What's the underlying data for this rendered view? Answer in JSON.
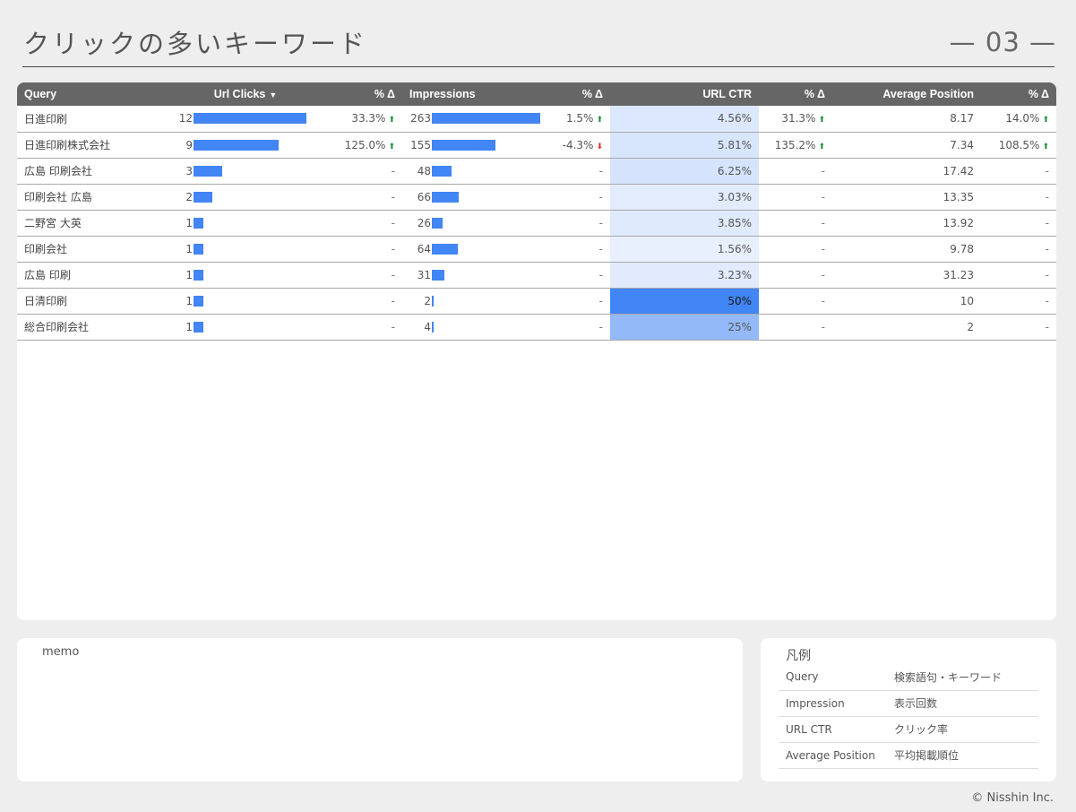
{
  "page": {
    "title": "クリックの多いキーワード",
    "number": "— 03 —",
    "copyright": "© Nisshin Inc."
  },
  "table": {
    "headers": {
      "query": "Query",
      "clicks": "Url Clicks",
      "clicks_delta": "% Δ",
      "impressions": "Impressions",
      "impressions_delta": "% Δ",
      "ctr": "URL CTR",
      "ctr_delta": "% Δ",
      "position": "Average Position",
      "position_delta": "% Δ"
    },
    "sort_caret": "▼",
    "rows": [
      {
        "query": "日進印刷",
        "clicks": "12",
        "clicks_value": 12,
        "clicks_delta": "33.3%",
        "clicks_dir": "up",
        "impressions": "263",
        "impressions_value": 263,
        "impressions_delta": "1.5%",
        "impressions_dir": "up",
        "ctr": "4.56%",
        "ctr_value": 4.56,
        "ctr_delta": "31.3%",
        "ctr_dir": "up",
        "position": "8.17",
        "position_delta": "14.0%",
        "position_dir": "up"
      },
      {
        "query": "日進印刷株式会社",
        "clicks": "9",
        "clicks_value": 9,
        "clicks_delta": "125.0%",
        "clicks_dir": "up",
        "impressions": "155",
        "impressions_value": 155,
        "impressions_delta": "-4.3%",
        "impressions_dir": "down",
        "ctr": "5.81%",
        "ctr_value": 5.81,
        "ctr_delta": "135.2%",
        "ctr_dir": "up",
        "position": "7.34",
        "position_delta": "108.5%",
        "position_dir": "up"
      },
      {
        "query": "広島 印刷会社",
        "clicks": "3",
        "clicks_value": 3,
        "clicks_delta": "-",
        "clicks_dir": "",
        "impressions": "48",
        "impressions_value": 48,
        "impressions_delta": "-",
        "impressions_dir": "",
        "ctr": "6.25%",
        "ctr_value": 6.25,
        "ctr_delta": "-",
        "ctr_dir": "",
        "position": "17.42",
        "position_delta": "-",
        "position_dir": ""
      },
      {
        "query": "印刷会社 広島",
        "clicks": "2",
        "clicks_value": 2,
        "clicks_delta": "-",
        "clicks_dir": "",
        "impressions": "66",
        "impressions_value": 66,
        "impressions_delta": "-",
        "impressions_dir": "",
        "ctr": "3.03%",
        "ctr_value": 3.03,
        "ctr_delta": "-",
        "ctr_dir": "",
        "position": "13.35",
        "position_delta": "-",
        "position_dir": ""
      },
      {
        "query": "二野宮 大英",
        "clicks": "1",
        "clicks_value": 1,
        "clicks_delta": "-",
        "clicks_dir": "",
        "impressions": "26",
        "impressions_value": 26,
        "impressions_delta": "-",
        "impressions_dir": "",
        "ctr": "3.85%",
        "ctr_value": 3.85,
        "ctr_delta": "-",
        "ctr_dir": "",
        "position": "13.92",
        "position_delta": "-",
        "position_dir": ""
      },
      {
        "query": "印刷会社",
        "clicks": "1",
        "clicks_value": 1,
        "clicks_delta": "-",
        "clicks_dir": "",
        "impressions": "64",
        "impressions_value": 64,
        "impressions_delta": "-",
        "impressions_dir": "",
        "ctr": "1.56%",
        "ctr_value": 1.56,
        "ctr_delta": "-",
        "ctr_dir": "",
        "position": "9.78",
        "position_delta": "-",
        "position_dir": ""
      },
      {
        "query": "広島 印刷",
        "clicks": "1",
        "clicks_value": 1,
        "clicks_delta": "-",
        "clicks_dir": "",
        "impressions": "31",
        "impressions_value": 31,
        "impressions_delta": "-",
        "impressions_dir": "",
        "ctr": "3.23%",
        "ctr_value": 3.23,
        "ctr_delta": "-",
        "ctr_dir": "",
        "position": "31.23",
        "position_delta": "-",
        "position_dir": ""
      },
      {
        "query": "日清印刷",
        "clicks": "1",
        "clicks_value": 1,
        "clicks_delta": "-",
        "clicks_dir": "",
        "impressions": "2",
        "impressions_value": 2,
        "impressions_delta": "-",
        "impressions_dir": "",
        "ctr": "50%",
        "ctr_value": 50,
        "ctr_delta": "-",
        "ctr_dir": "",
        "position": "10",
        "position_delta": "-",
        "position_dir": ""
      },
      {
        "query": "総合印刷会社",
        "clicks": "1",
        "clicks_value": 1,
        "clicks_delta": "-",
        "clicks_dir": "",
        "impressions": "4",
        "impressions_value": 4,
        "impressions_delta": "-",
        "impressions_dir": "",
        "ctr": "25%",
        "ctr_value": 25,
        "ctr_delta": "-",
        "ctr_dir": "",
        "position": "2",
        "position_delta": "-",
        "position_dir": ""
      }
    ]
  },
  "memo": {
    "title": "memo"
  },
  "legend": {
    "title": "凡例",
    "items": [
      {
        "term": "Query",
        "desc": "検索語句・キーワード"
      },
      {
        "term": "Impression",
        "desc": "表示回数"
      },
      {
        "term": "URL CTR",
        "desc": "クリック率"
      },
      {
        "term": "Average Position",
        "desc": "平均掲載順位"
      }
    ]
  },
  "colors": {
    "bar": "#4285f4",
    "up": "#1e8e3e",
    "down": "#d93025",
    "header_bg": "#666666"
  },
  "icons": {
    "up": "arrow-up-icon",
    "down": "arrow-down-icon"
  }
}
